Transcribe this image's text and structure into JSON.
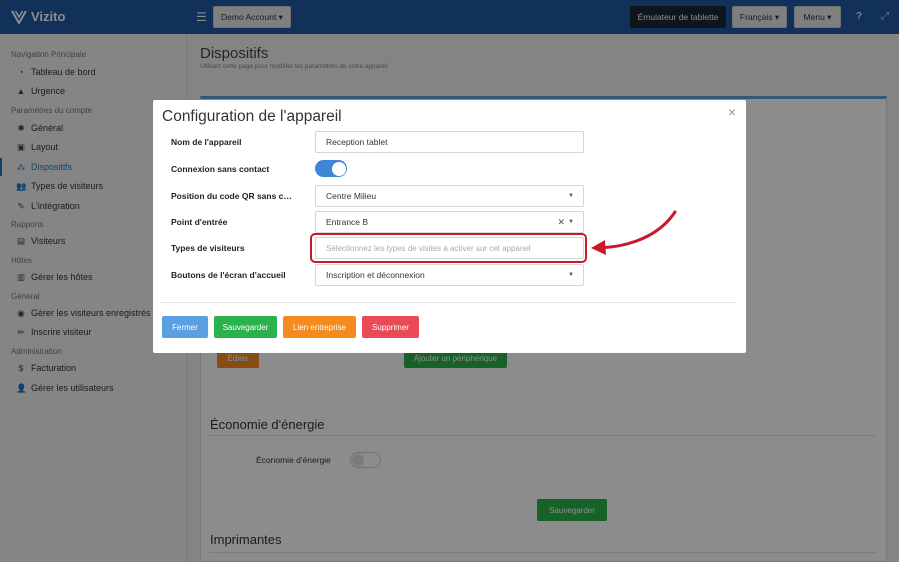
{
  "header": {
    "logo_text": "Vizito",
    "account_button": "Demo Account ▾",
    "emulator_button": "Émulateur de tablette",
    "language_button": "Français ▾",
    "menu_button": "Menu ▾",
    "help_icon": "?",
    "expand_icon": "⤢"
  },
  "sidebar": {
    "sections": [
      {
        "heading": "Navigation Principale"
      },
      {
        "heading": "Paramètres du compte"
      },
      {
        "heading": "Rapports"
      },
      {
        "heading": "Hôtes"
      },
      {
        "heading": "Général"
      },
      {
        "heading": "Administration"
      }
    ],
    "items": [
      {
        "label": "Tableau de bord",
        "icon": "dashboard-icon",
        "glyph": "◔"
      },
      {
        "label": "Urgence",
        "icon": "warning-icon",
        "glyph": "▲"
      },
      {
        "label": "Général",
        "icon": "gear-icon",
        "glyph": "✱"
      },
      {
        "label": "Layout",
        "icon": "image-icon",
        "glyph": "▣"
      },
      {
        "label": "Dispositifs",
        "icon": "sitemap-icon",
        "glyph": "⁂"
      },
      {
        "label": "Types de visiteurs",
        "icon": "users-icon",
        "glyph": "👥"
      },
      {
        "label": "L'intégration",
        "icon": "plug-icon",
        "glyph": "✎"
      },
      {
        "label": "Visiteurs",
        "icon": "book-icon",
        "glyph": "▤"
      },
      {
        "label": "Gérer les hôtes",
        "icon": "building-icon",
        "glyph": "▥"
      },
      {
        "label": "Gérer les visiteurs enregistrés",
        "icon": "user-circle-icon",
        "glyph": "◉"
      },
      {
        "label": "Inscrire visiteur",
        "icon": "pen-icon",
        "glyph": "✏"
      },
      {
        "label": "Facturation",
        "icon": "dollar-icon",
        "glyph": "$"
      },
      {
        "label": "Gérer les utilisateurs",
        "icon": "user-cog-icon",
        "glyph": "👤"
      }
    ]
  },
  "page": {
    "title": "Dispositifs",
    "subtitle": "Utilisez cette page pour modifier les paramètres de votre appareil",
    "edit_button": "Éditer",
    "add_device_button": "Ajouter un périphérique",
    "energy_title": "Économie d'énergie",
    "energy_label": "Économie d'énergie",
    "save_button": "Sauvegarder",
    "printers_title": "Imprimantes"
  },
  "modal": {
    "title": "Configuration de l'appareil",
    "close": "×",
    "fields": {
      "device_name_label": "Nom de l'appareil",
      "device_name_value": "Reception tablet",
      "contactless_label": "Connexion sans contact",
      "qr_position_label": "Position du code QR sans contact",
      "qr_position_value": "Centre Milieu",
      "entry_point_label": "Point d'entrée",
      "entry_point_value": "Entrance B",
      "visitor_types_label": "Types de visiteurs",
      "visitor_types_placeholder": "Sélectionnez les types de visites à activer sur cet appareil",
      "home_buttons_label": "Boutons de l'écran d'accueil",
      "home_buttons_value": "Inscription et déconnexion"
    },
    "contactless_enabled": true,
    "buttons": {
      "close": "Fermer",
      "save": "Sauvegarder",
      "company_link": "Lien entreprise",
      "delete": "Supprimer"
    }
  },
  "colors": {
    "header": "#1f5aa7",
    "primary": "#5b9fe3",
    "success": "#2bb24c",
    "warning": "#f58a1f",
    "danger": "#e94a55",
    "highlight": "#c8192c"
  }
}
